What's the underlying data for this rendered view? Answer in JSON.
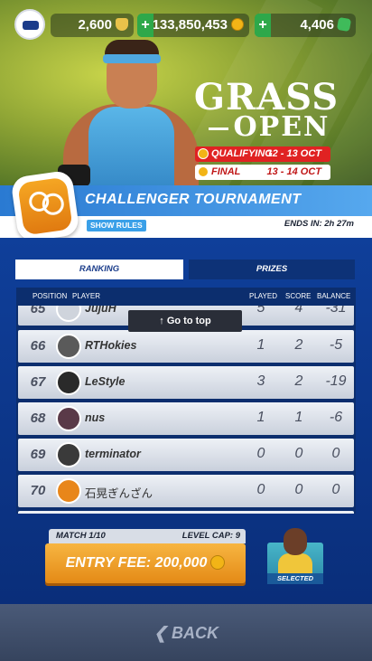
{
  "header": {
    "trophies": "2,600",
    "coins": "133,850,453",
    "gems": "4,406",
    "add_coins_label": "+",
    "add_gems_label": "+"
  },
  "event": {
    "title_line1": "GRASS",
    "title_line2": "OPEN",
    "stages": [
      {
        "name": "QUALIFYING",
        "dates": "12 - 13 OCT"
      },
      {
        "name": "FINAL",
        "dates": "13 - 14 OCT"
      }
    ]
  },
  "tournament": {
    "title": "CHALLENGER TOURNAMENT",
    "show_rules": "SHOW RULES",
    "ends_in": "ENDS IN: 2h 27m"
  },
  "tabs": {
    "ranking": "RANKING",
    "prizes": "PRIZES"
  },
  "table": {
    "columns": {
      "position": "POSITION",
      "player": "PLAYER",
      "played": "PLAYED",
      "score": "SCORE",
      "balance": "BALANCE"
    },
    "rows": [
      {
        "position": "65",
        "player": "JujuH",
        "played": "5",
        "score": "4",
        "balance": "-31"
      },
      {
        "position": "66",
        "player": "RTHokies",
        "played": "1",
        "score": "2",
        "balance": "-5"
      },
      {
        "position": "67",
        "player": "LeStyle",
        "played": "3",
        "score": "2",
        "balance": "-19"
      },
      {
        "position": "68",
        "player": "nus",
        "played": "1",
        "score": "1",
        "balance": "-6"
      },
      {
        "position": "69",
        "player": "terminator",
        "played": "0",
        "score": "0",
        "balance": "0"
      },
      {
        "position": "70",
        "player": "石晃ぎんざん",
        "played": "0",
        "score": "0",
        "balance": "0"
      }
    ],
    "go_to_top": "↑ Go to top"
  },
  "entry": {
    "match": "MATCH 1/10",
    "level_cap": "LEVEL CAP: 9",
    "fee_label": "ENTRY FEE: 200,000",
    "selected_label": "SELECTED"
  },
  "footer": {
    "back_label": "BACK"
  },
  "colors": {
    "accent_blue": "#2a7ad2",
    "entry_orange": "#e48a16",
    "qualifying_red": "#e02222"
  },
  "icons": [
    "vr-avatar-icon",
    "trophy-icon",
    "coin-icon",
    "gem-icon",
    "tournament-badge-icon",
    "chevron-left-icon"
  ]
}
